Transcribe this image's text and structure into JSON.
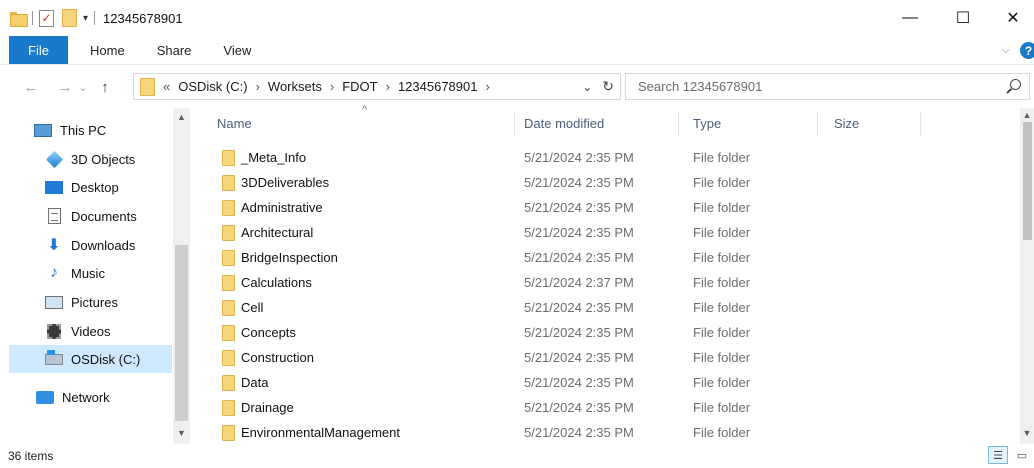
{
  "window": {
    "title": "12345678901",
    "controls": {
      "minimize": "—",
      "maximize": "☐",
      "close": "✕"
    }
  },
  "quick_access": {
    "customize_arrow": "▾"
  },
  "ribbon": {
    "tabs": [
      {
        "label": "File",
        "active": true
      },
      {
        "label": "Home"
      },
      {
        "label": "Share"
      },
      {
        "label": "View"
      }
    ],
    "expand_chevron": "⌵",
    "help": "?"
  },
  "navigation": {
    "back": "←",
    "forward": "→",
    "recent": "⌄",
    "up": "↑",
    "overflow": "«",
    "breadcrumb": [
      "OSDisk (C:)",
      "Worksets",
      "FDOT",
      "12345678901"
    ],
    "crumb_separator": "›",
    "dropdown": "⌄",
    "refresh": "↻",
    "search_placeholder": "Search 12345678901"
  },
  "nav_pane": {
    "items": [
      {
        "label": "This PC",
        "icon": "computer-icon"
      },
      {
        "label": "3D Objects",
        "icon": "3d-objects-icon"
      },
      {
        "label": "Desktop",
        "icon": "desktop-icon"
      },
      {
        "label": "Documents",
        "icon": "documents-icon"
      },
      {
        "label": "Downloads",
        "icon": "downloads-icon"
      },
      {
        "label": "Music",
        "icon": "music-icon"
      },
      {
        "label": "Pictures",
        "icon": "pictures-icon"
      },
      {
        "label": "Videos",
        "icon": "videos-icon"
      },
      {
        "label": "OSDisk (C:)",
        "icon": "drive-icon",
        "selected": true
      },
      {
        "label": "Network",
        "icon": "network-icon"
      }
    ]
  },
  "columns": {
    "name": "Name",
    "date": "Date modified",
    "type": "Type",
    "size": "Size",
    "sort_indicator": "^"
  },
  "files": [
    {
      "name": "_Meta_Info",
      "date": "5/21/2024 2:35 PM",
      "type": "File folder"
    },
    {
      "name": "3DDeliverables",
      "date": "5/21/2024 2:35 PM",
      "type": "File folder"
    },
    {
      "name": "Administrative",
      "date": "5/21/2024 2:35 PM",
      "type": "File folder"
    },
    {
      "name": "Architectural",
      "date": "5/21/2024 2:35 PM",
      "type": "File folder"
    },
    {
      "name": "BridgeInspection",
      "date": "5/21/2024 2:35 PM",
      "type": "File folder"
    },
    {
      "name": "Calculations",
      "date": "5/21/2024 2:37 PM",
      "type": "File folder"
    },
    {
      "name": "Cell",
      "date": "5/21/2024 2:35 PM",
      "type": "File folder"
    },
    {
      "name": "Concepts",
      "date": "5/21/2024 2:35 PM",
      "type": "File folder"
    },
    {
      "name": "Construction",
      "date": "5/21/2024 2:35 PM",
      "type": "File folder"
    },
    {
      "name": "Data",
      "date": "5/21/2024 2:35 PM",
      "type": "File folder"
    },
    {
      "name": "Drainage",
      "date": "5/21/2024 2:35 PM",
      "type": "File folder"
    },
    {
      "name": "EnvironmentalManagement",
      "date": "5/21/2024 2:35 PM",
      "type": "File folder"
    }
  ],
  "status": {
    "item_count": "36 items"
  },
  "colors": {
    "accent": "#1979ca",
    "selection": "#cde8ff",
    "folder": "#f8d57a"
  }
}
